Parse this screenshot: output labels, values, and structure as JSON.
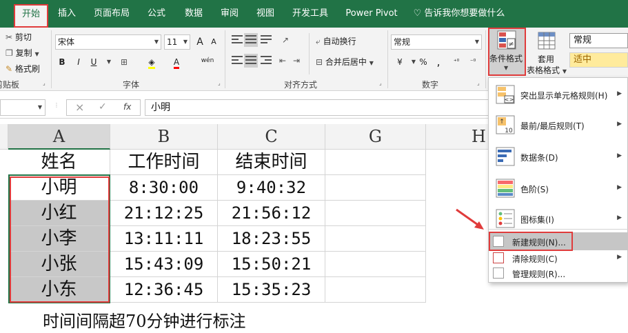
{
  "tabs": [
    "开始",
    "插入",
    "页面布局",
    "公式",
    "数据",
    "审阅",
    "视图",
    "开发工具",
    "Power Pivot"
  ],
  "tell_me": "告诉我你想要做什么",
  "clipboard": {
    "cut": "剪切",
    "copy": "复制",
    "painter": "格式刷",
    "title": "剪贴板"
  },
  "font": {
    "name": "宋体",
    "size": "11",
    "title": "字体",
    "bold": "B",
    "italic": "I",
    "underline": "U",
    "grow": "A",
    "shrink": "A",
    "color_a": "A",
    "phonetic": "wén"
  },
  "alignment": {
    "wrap": "自动换行",
    "merge": "合并后居中",
    "title": "对齐方式"
  },
  "number": {
    "format": "常规",
    "title": "数字",
    "currency": "¥",
    "percent": "%"
  },
  "styles": {
    "cond_format_line1": "条件格式",
    "table_line1": "套用",
    "table_line2": "表格格式",
    "style_normal": "常规",
    "style_neutral": "适中"
  },
  "formula_bar": {
    "cancel": "×",
    "enter": "✓",
    "fx": "fx",
    "content": "小明"
  },
  "columns": [
    "A",
    "B",
    "C",
    "G",
    "H"
  ],
  "table": {
    "header": [
      "姓名",
      "工作时间",
      "结束时间"
    ],
    "rows": [
      [
        "小明",
        "8:30:00",
        "9:40:32"
      ],
      [
        "小红",
        "21:12:25",
        "21:56:12"
      ],
      [
        "小李",
        "13:11:11",
        "18:23:55"
      ],
      [
        "小张",
        "15:43:09",
        "15:50:21"
      ],
      [
        "小东",
        "12:36:45",
        "15:35:23"
      ]
    ],
    "note": "时间间隔超70分钟进行标注"
  },
  "menu": {
    "items": [
      "突出显示单元格规则(H)",
      "最前/最后规则(T)",
      "数据条(D)",
      "色阶(S)",
      "图标集(I)"
    ],
    "new_rule": "新建规则(N)...",
    "clear_rule": "清除规则(C)",
    "manage_rule": "管理规则(R)..."
  },
  "colors": {
    "excel_green": "#217346",
    "highlight_red": "#e03b3b",
    "neutral_fill": "#ffeb9c",
    "neutral_text": "#9c6500"
  }
}
